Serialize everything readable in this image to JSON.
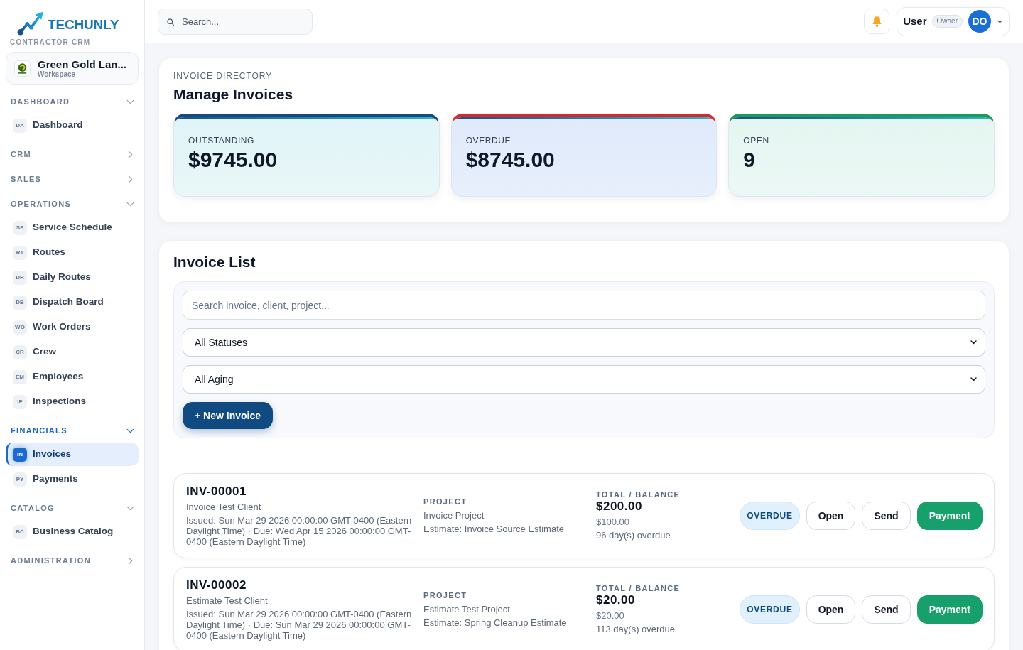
{
  "sidebar": {
    "brand": {
      "name": "TECHUNLY",
      "tagline": "CONTRACTOR CRM"
    },
    "workspace": {
      "name": "Green Gold Lan...",
      "label": "Workspace"
    },
    "sections": [
      {
        "title": "DASHBOARD",
        "expanded": true,
        "items": [
          {
            "badge": "DA",
            "label": "Dashboard",
            "selected": false
          }
        ]
      },
      {
        "title": "CRM",
        "expanded": false
      },
      {
        "title": "SALES",
        "expanded": false
      },
      {
        "title": "OPERATIONS",
        "expanded": true,
        "items": [
          {
            "badge": "SS",
            "label": "Service Schedule",
            "selected": false
          },
          {
            "badge": "RT",
            "label": "Routes",
            "selected": false
          },
          {
            "badge": "DR",
            "label": "Daily Routes",
            "selected": false
          },
          {
            "badge": "DB",
            "label": "Dispatch Board",
            "selected": false
          },
          {
            "badge": "WO",
            "label": "Work Orders",
            "selected": false
          },
          {
            "badge": "CR",
            "label": "Crew",
            "selected": false
          },
          {
            "badge": "EM",
            "label": "Employees",
            "selected": false
          },
          {
            "badge": "IP",
            "label": "Inspections",
            "selected": false
          }
        ]
      },
      {
        "title": "FINANCIALS",
        "expanded": true,
        "items": [
          {
            "badge": "IN",
            "label": "Invoices",
            "selected": true
          },
          {
            "badge": "PY",
            "label": "Payments",
            "selected": false
          }
        ]
      },
      {
        "title": "CATALOG",
        "expanded": true,
        "items": [
          {
            "badge": "BC",
            "label": "Business Catalog",
            "selected": false
          }
        ]
      },
      {
        "title": "ADMINISTRATION",
        "expanded": false
      }
    ]
  },
  "topbar": {
    "search": {
      "placeholder": "Search..."
    },
    "user": {
      "name": "User",
      "role": "Owner",
      "initials": "DO"
    }
  },
  "directory": {
    "eyebrow": "INVOICE DIRECTORY",
    "title": "Manage Invoices",
    "stats": [
      {
        "label": "OUTSTANDING",
        "value": "$9745.00",
        "color": "#15497f"
      },
      {
        "label": "OVERDUE",
        "value": "$8745.00",
        "color": "#d62a2a"
      },
      {
        "label": "OPEN",
        "value": "9",
        "color": "#1c9a5a"
      }
    ]
  },
  "invoice_list": {
    "title": "Invoice List",
    "search": {
      "placeholder": "Search invoice, client, project..."
    },
    "filters": [
      {
        "value": "All Statuses"
      },
      {
        "value": "All Aging"
      }
    ],
    "new_button": "+ New Invoice",
    "invoices": [
      {
        "number": "INV-00001",
        "client": "Invoice Test Client",
        "dates": "Issued: Sun Mar 29 2026 00:00:00 GMT-0400 (Eastern Daylight Time) · Due: Wed Apr 15 2026 00:00:00 GMT-0400 (Eastern Daylight Time)",
        "project_label": "PROJECT",
        "project": "Invoice Project",
        "estimate": "Estimate: Invoice Source Estimate",
        "amount_label": "TOTAL / BALANCE",
        "total": "$200.00",
        "balance": "$100.00",
        "aging": "96 day(s) overdue",
        "status": "OVERDUE",
        "actions": [
          {
            "label": "Open",
            "kind": "secondary"
          },
          {
            "label": "Send",
            "kind": "secondary"
          },
          {
            "label": "Payment",
            "kind": "primary"
          }
        ]
      },
      {
        "number": "INV-00002",
        "client": "Estimate Test Client",
        "dates": "Issued: Sun Mar 29 2026 00:00:00 GMT-0400 (Eastern Daylight Time) · Due: Sun Mar 29 2026 00:00:00 GMT-0400 (Eastern Daylight Time)",
        "project_label": "PROJECT",
        "project": "Estimate Test Project",
        "estimate": "Estimate: Spring Cleanup Estimate",
        "amount_label": "TOTAL / BALANCE",
        "total": "$20.00",
        "balance": "$20.00",
        "aging": "113 day(s) overdue",
        "status": "OVERDUE",
        "actions": [
          {
            "label": "Open",
            "kind": "secondary"
          },
          {
            "label": "Send",
            "kind": "secondary"
          },
          {
            "label": "Payment",
            "kind": "primary"
          }
        ]
      }
    ]
  }
}
